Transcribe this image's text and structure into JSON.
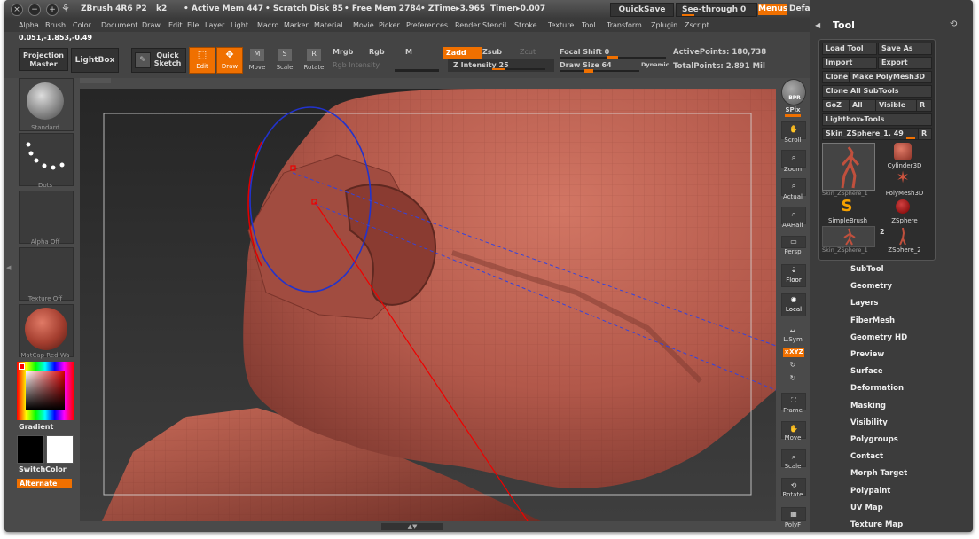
{
  "titlebar": {
    "app": "ZBrush 4R6 P2",
    "k2": "k2",
    "active_mem": "• Active Mem 447",
    "scratch_disk": "• Scratch Disk 85",
    "free_mem": "• Free Mem 2784",
    "ztime": "• ZTime▸3.965",
    "timer": "Timer▸0.007",
    "quicksave": "QuickSave",
    "see_through": "See-through",
    "see_through_value": "0",
    "menus": "Menus",
    "default_zscript": "DefaultZScript"
  },
  "menubar": [
    "Alpha",
    "Brush",
    "Color",
    "Document",
    "Draw",
    "Edit",
    "File",
    "Layer",
    "Light",
    "Macro",
    "Marker",
    "Material",
    "Movie",
    "Picker",
    "Preferences",
    "Render",
    "Stencil",
    "Stroke",
    "Texture",
    "Tool",
    "Transform",
    "Zplugin",
    "Zscript"
  ],
  "coords": "0.051,-1.853,-0.49",
  "topshelf": {
    "projection_master": "Projection Master",
    "lightbox": "LightBox",
    "quick_sketch": "Quick Sketch",
    "edit": "Edit",
    "draw": "Draw",
    "move": "Move",
    "scale": "Scale",
    "rotate": "Rotate",
    "mrgb": "Mrgb",
    "rgb": "Rgb",
    "m": "M",
    "rgb_intensity": "Rgb Intensity",
    "zadd": "Zadd",
    "zsub": "Zsub",
    "zcut": "Zcut",
    "z_intensity": "Z Intensity 25",
    "z_intensity_level": 0.25,
    "focal_shift": "Focal Shift 0",
    "draw_size": "Draw Size 64",
    "dynamic": "Dynamic",
    "active_points": "ActivePoints: 180,738",
    "total_points": "TotalPoints: 2.891 Mil"
  },
  "leftshelf": {
    "brush": "Standard",
    "stroke": "Dots",
    "alpha": "Alpha Off",
    "texture": "Texture Off",
    "material": "MatCap Red Wa",
    "gradient": "Gradient",
    "switch_color": "SwitchColor",
    "alternate": "Alternate"
  },
  "rightshelf": {
    "bpr": "BPR",
    "spix": "SPix",
    "scroll": "Scroll",
    "zoom": "Zoom",
    "actual": "Actual",
    "aahalf": "AAHalf",
    "persp": "Persp",
    "floor": "Floor",
    "local": "Local",
    "lsym": "L.Sym",
    "xyz": "⨯XYZ",
    "frame": "Frame",
    "move": "Move",
    "scale": "Scale",
    "rotate": "Rotate",
    "polyf": "PolyF"
  },
  "tool": {
    "title": "Tool",
    "load_tool": "Load Tool",
    "save_as": "Save As",
    "import": "Import",
    "export": "Export",
    "clone": "Clone",
    "make_polymesh": "Make PolyMesh3D",
    "clone_all": "Clone All SubTools",
    "goz": "GoZ",
    "all": "All",
    "visible": "Visible",
    "r": "R",
    "lightbox_tools": "Lightbox▸Tools",
    "current_tool": "Skin_ZSphere_1. 49",
    "thumb_main": "Skin_ZSphere_1",
    "cylinder": "Cylinder3D",
    "polymesh": "PolyMesh3D",
    "simplebrush": "SimpleBrush",
    "zsphere": "ZSphere",
    "skin1": "Skin_ZSphere_1",
    "count2": "2",
    "skin2": "ZSphere_2"
  },
  "subpalettes": [
    "SubTool",
    "Geometry",
    "Layers",
    "FiberMesh",
    "Geometry HD",
    "Preview",
    "Surface",
    "Deformation",
    "Masking",
    "Visibility",
    "Polygroups",
    "Contact",
    "Morph Target",
    "Polypaint",
    "UV Map",
    "Texture Map"
  ],
  "colors": {
    "accent": "#f07000",
    "model": "#b5564a",
    "background": "#4a4a4a"
  }
}
